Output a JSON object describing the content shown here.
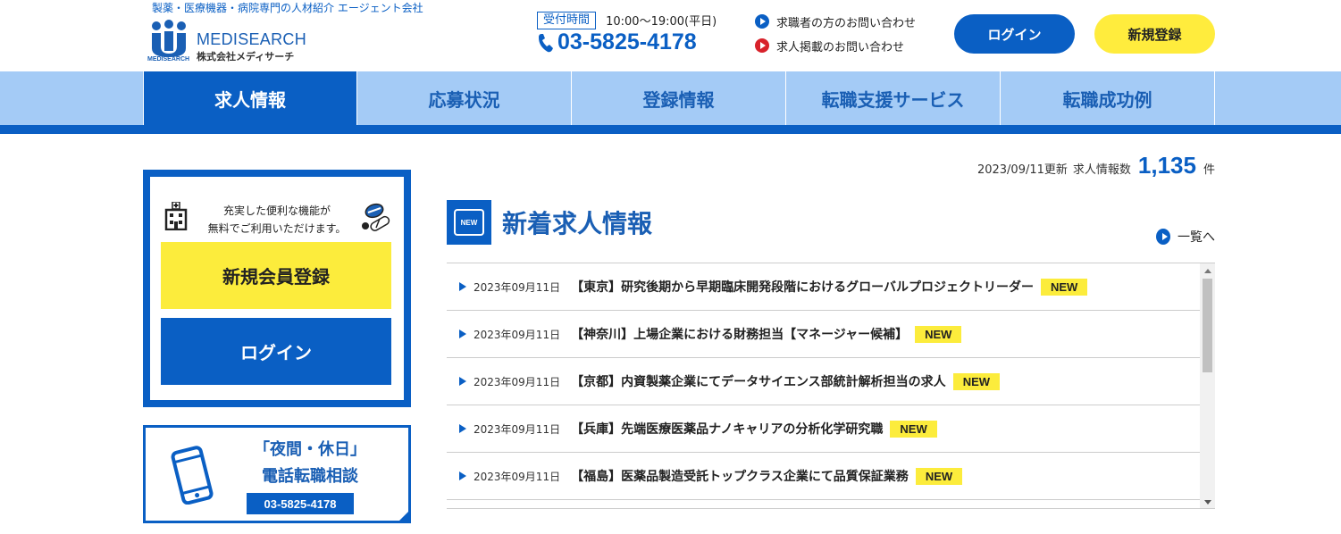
{
  "header": {
    "tagline": "製薬・医療機器・病院専門の人材紹介 エージェント会社",
    "logo_en": "MEDISEARCH",
    "logo_jp": "株式会社メディサーチ",
    "logo_sub": "MEDISEARCH",
    "hours_badge": "受付時間",
    "hours_time": "10:00〜19:00(平日)",
    "phone": "03-5825-4178",
    "contact_links": [
      {
        "label": "求職者の方のお問い合わせ",
        "color": "#0a5fc4"
      },
      {
        "label": "求人掲載のお問い合わせ",
        "color": "#d8222b"
      }
    ],
    "login_label": "ログイン",
    "register_label": "新規登録"
  },
  "nav": {
    "items": [
      {
        "label": "求人情報",
        "active": true
      },
      {
        "label": "応募状況",
        "active": false
      },
      {
        "label": "登録情報",
        "active": false
      },
      {
        "label": "転職支援サービス",
        "active": false
      },
      {
        "label": "転職成功例",
        "active": false
      }
    ]
  },
  "sidebar": {
    "member_msg_line1": "充実した便利な機能が",
    "member_msg_line2": "無料でご利用いただけます。",
    "register_button": "新規会員登録",
    "login_button": "ログイン",
    "night_title1": "「夜間・休日」",
    "night_title2": "電話転職相談",
    "night_phone": "03-5825-4178"
  },
  "main": {
    "update_date": "2023/09/11更新",
    "update_label": "求人情報数",
    "update_count": "1,135",
    "update_unit": "件",
    "section_icon_text": "NEW",
    "section_title": "新着求人情報",
    "list_link": "一覧へ",
    "jobs": [
      {
        "date": "2023年09月11日",
        "title": "【東京】研究後期から早期臨床開発段階におけるグローバルプロジェクトリーダー",
        "badge": "NEW"
      },
      {
        "date": "2023年09月11日",
        "title": "【神奈川】上場企業における財務担当【マネージャー候補】",
        "badge": "NEW"
      },
      {
        "date": "2023年09月11日",
        "title": "【京都】内資製薬企業にてデータサイエンス部統計解析担当の求人",
        "badge": "NEW"
      },
      {
        "date": "2023年09月11日",
        "title": "【兵庫】先端医療医薬品ナノキャリアの分析化学研究職",
        "badge": "NEW"
      },
      {
        "date": "2023年09月11日",
        "title": "【福島】医薬品製造受託トップクラス企業にて品質保証業務",
        "badge": "NEW"
      }
    ]
  },
  "colors": {
    "primary": "#0a5fc4",
    "nav_bg": "#a4cbf6",
    "accent_yellow": "#fcec3c",
    "accent_red": "#d8222b"
  }
}
